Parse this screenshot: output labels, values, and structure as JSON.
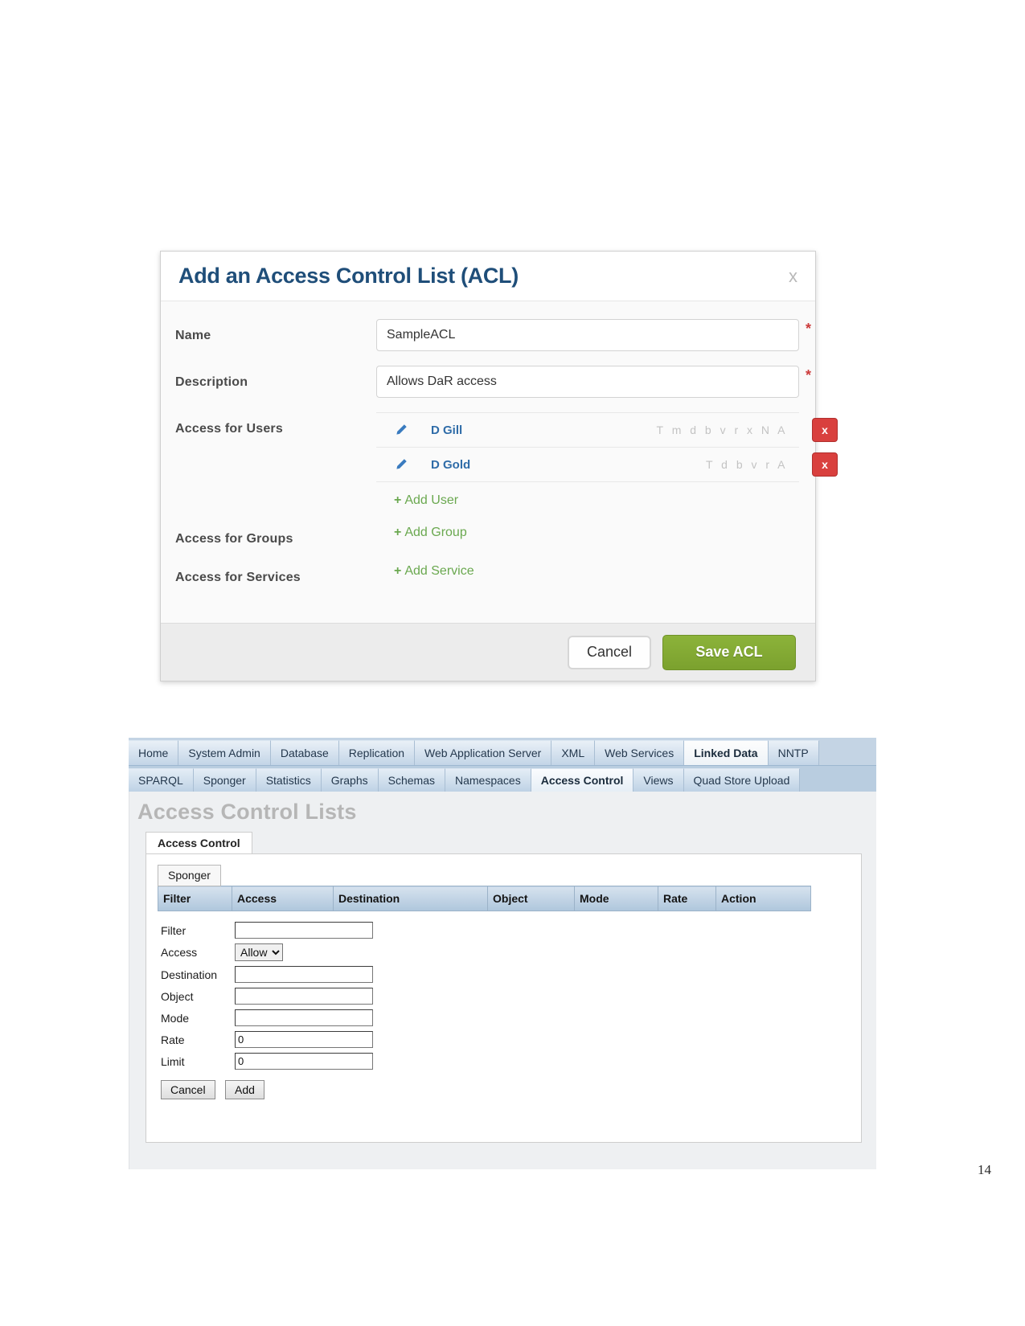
{
  "dialog": {
    "title": "Add an Access Control List (ACL)",
    "close_label": "x",
    "fields": {
      "name_label": "Name",
      "name_value": "SampleACL",
      "description_label": "Description",
      "description_value": "Allows DaR access",
      "required_marker": "*",
      "users_label": "Access for Users",
      "groups_label": "Access for Groups",
      "services_label": "Access for Services"
    },
    "users": [
      {
        "name": "D Gill",
        "permissions": "T m d b v r x N A",
        "delete_label": "x"
      },
      {
        "name": "D Gold",
        "permissions": "T d b v r A",
        "delete_label": "x"
      }
    ],
    "add_user_label": "Add User",
    "add_group_label": "Add Group",
    "add_service_label": "Add Service",
    "plus": "+",
    "footer": {
      "cancel_label": "Cancel",
      "save_label": "Save ACL"
    },
    "colors": {
      "title": "#1f4e79",
      "link_green": "#6aa84f",
      "save_green": "#7ba12e",
      "delete_red": "#d9403e",
      "user_blue": "#2f6ca8"
    }
  },
  "admin": {
    "tabs_row1": [
      {
        "label": "Home",
        "active": false
      },
      {
        "label": "System Admin",
        "active": false
      },
      {
        "label": "Database",
        "active": false
      },
      {
        "label": "Replication",
        "active": false
      },
      {
        "label": "Web Application Server",
        "active": false
      },
      {
        "label": "XML",
        "active": false
      },
      {
        "label": "Web Services",
        "active": false
      },
      {
        "label": "Linked Data",
        "active": true
      },
      {
        "label": "NNTP",
        "active": false
      }
    ],
    "tabs_row2": [
      {
        "label": "SPARQL",
        "active": false
      },
      {
        "label": "Sponger",
        "active": false
      },
      {
        "label": "Statistics",
        "active": false
      },
      {
        "label": "Graphs",
        "active": false
      },
      {
        "label": "Schemas",
        "active": false
      },
      {
        "label": "Namespaces",
        "active": false
      },
      {
        "label": "Access Control",
        "active": true
      },
      {
        "label": "Views",
        "active": false
      },
      {
        "label": "Quad Store Upload",
        "active": false
      }
    ],
    "page_heading": "Access Control Lists",
    "subtab_label": "Access Control",
    "sponger_tab_label": "Sponger",
    "table_headers": [
      "Filter",
      "Access",
      "Destination",
      "Object",
      "Mode",
      "Rate",
      "Action"
    ],
    "form_fields": [
      {
        "label": "Filter",
        "type": "text",
        "value": ""
      },
      {
        "label": "Access",
        "type": "select",
        "value": "Allow"
      },
      {
        "label": "Destination",
        "type": "text",
        "value": ""
      },
      {
        "label": "Object",
        "type": "text",
        "value": ""
      },
      {
        "label": "Mode",
        "type": "text",
        "value": ""
      },
      {
        "label": "Rate",
        "type": "text",
        "value": "0"
      },
      {
        "label": "Limit",
        "type": "text",
        "value": "0"
      }
    ],
    "buttons": {
      "cancel_label": "Cancel",
      "add_label": "Add"
    }
  },
  "page_number": "14"
}
